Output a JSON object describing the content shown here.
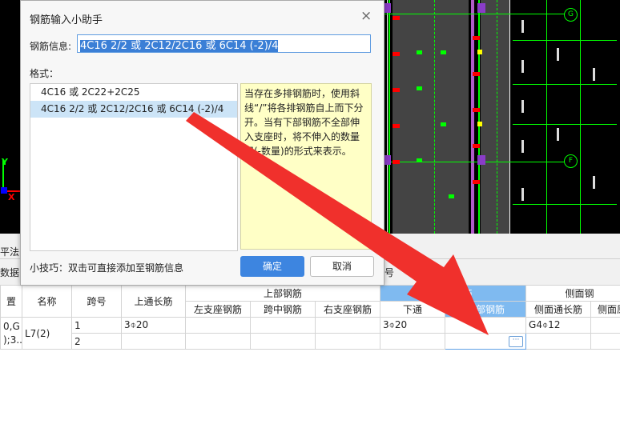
{
  "dialog": {
    "title": "钢筋输入小助手",
    "close_glyph": "×",
    "info_label": "钢筋信息:",
    "info_value": "4C16 2/2 或 2C12/2C16 或 6C14 (-2)/4",
    "format_label": "格式：",
    "format_items": [
      "4C16 或 2C22+2C25",
      "4C16 2/2 或 2C12/2C16 或 6C14 (-2)/4"
    ],
    "hint": "当存在多排钢筋时，使用斜线“/”将各排钢筋自上而下分开。当有下部钢筋不全部伸入支座时，将不伸入的数量用(-数量)的形式来表示。",
    "tip": "小技巧：双击可直接添加至钢筋信息",
    "ok_label": "确定",
    "cancel_label": "取消"
  },
  "cad": {
    "axis_y": "Y",
    "axis_x": "X",
    "bubbles": [
      "G",
      "F"
    ]
  },
  "tab_strip": {
    "left_top": "平法",
    "left_bottom": "数据",
    "right_bottom": "号"
  },
  "table": {
    "headers_top": {
      "upper": "上部钢筋",
      "lower": "下部钢筋",
      "side": "侧面钢"
    },
    "headers": {
      "col0": "置",
      "name": "名称",
      "span": "跨号",
      "top_through": "上通长筋",
      "left_support": "左支座钢筋",
      "mid_span": "跨中钢筋",
      "right_support": "右支座钢筋",
      "bottom_through": "下通",
      "bottom_rebar": "下部钢筋",
      "side_through": "侧面通长筋",
      "side_cut": "侧面原"
    },
    "rows": [
      {
        "col0": "0,G",
        "name": "L7(2)",
        "span": "1",
        "top_through": "3⌽20",
        "bottom_through": "3⌽20",
        "side_through": "G4⌽12"
      },
      {
        "col0": ");3...",
        "span": "2"
      }
    ],
    "ellipsis": "···"
  },
  "colors": {
    "accent": "#3d85e0",
    "header_highlight": "#b8dbf6",
    "hint_bg": "#ffffc6",
    "arrow": "#f0302c"
  }
}
